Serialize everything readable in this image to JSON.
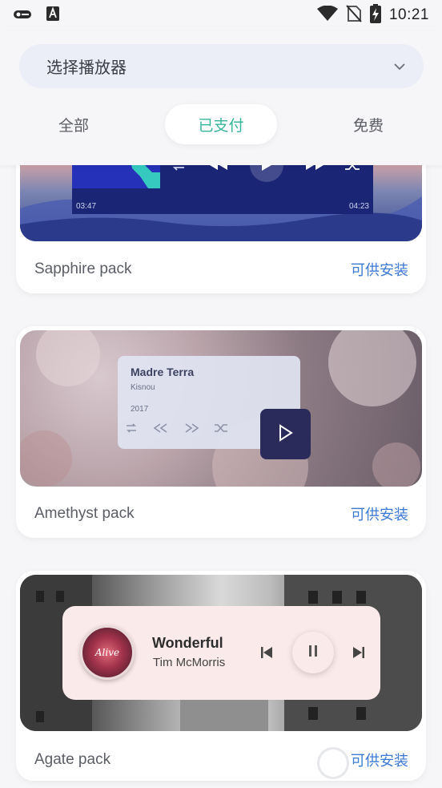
{
  "status_bar": {
    "time": "10:21",
    "left_icons": [
      "key-icon",
      "text-a-icon"
    ],
    "right_icons": [
      "wifi-icon",
      "no-sim-icon",
      "battery-charging-icon"
    ]
  },
  "player_select": {
    "label": "选择播放器",
    "icon": "chevron-down-icon"
  },
  "tabs": [
    {
      "label": "全部",
      "active": false
    },
    {
      "label": "已支付",
      "active": true
    },
    {
      "label": "免费",
      "active": false
    }
  ],
  "colors": {
    "accent": "#37b59a",
    "link": "#3c7ad6",
    "background": "#f6f6f8"
  },
  "packs": [
    {
      "name": "Sapphire pack",
      "status": "可供安装",
      "preview": {
        "time_start": "03:47",
        "time_end": "04:23"
      }
    },
    {
      "name": "Amethyst pack",
      "status": "可供安装",
      "preview": {
        "title": "Madre Terra",
        "artist": "Kisnou",
        "year": "2017"
      }
    },
    {
      "name": "Agate pack",
      "status": "可供安装",
      "preview": {
        "song": "Wonderful",
        "artist": "Tim McMorris",
        "album_text": "Alive"
      }
    }
  ]
}
